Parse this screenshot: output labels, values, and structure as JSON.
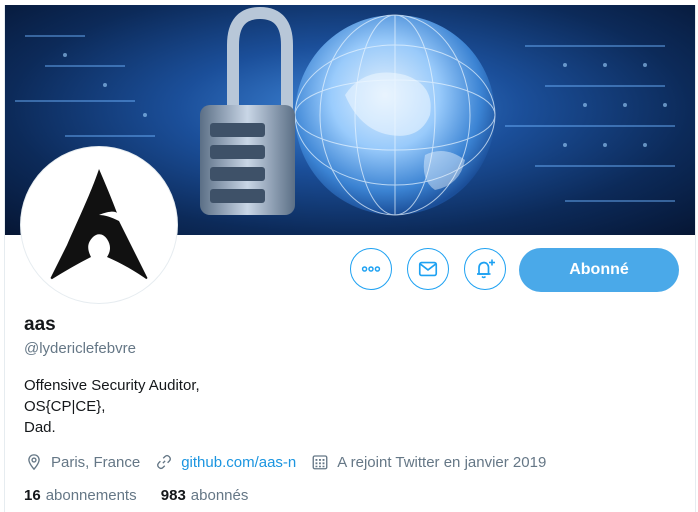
{
  "profile": {
    "name": "aas",
    "handle": "@lydericlefebvre",
    "bio": [
      "Offensive Security Auditor,",
      "OS{CP|CE},",
      "Dad."
    ]
  },
  "actions": {
    "follow_label": "Abonné"
  },
  "meta": {
    "location": "Paris, France",
    "website": "github.com/aas-n",
    "joined": "A rejoint Twitter en janvier 2019"
  },
  "stats": {
    "following_count": "16",
    "following_label": "abonnements",
    "followers_count": "983",
    "followers_label": "abonnés"
  },
  "colors": {
    "accent": "#1da1f2",
    "follow_button": "#4aa9e9",
    "link": "#1b95e0",
    "muted": "#657786"
  },
  "icons": [
    "more-icon",
    "mail-icon",
    "bell-plus-icon",
    "location-icon",
    "link-icon",
    "calendar-icon"
  ]
}
